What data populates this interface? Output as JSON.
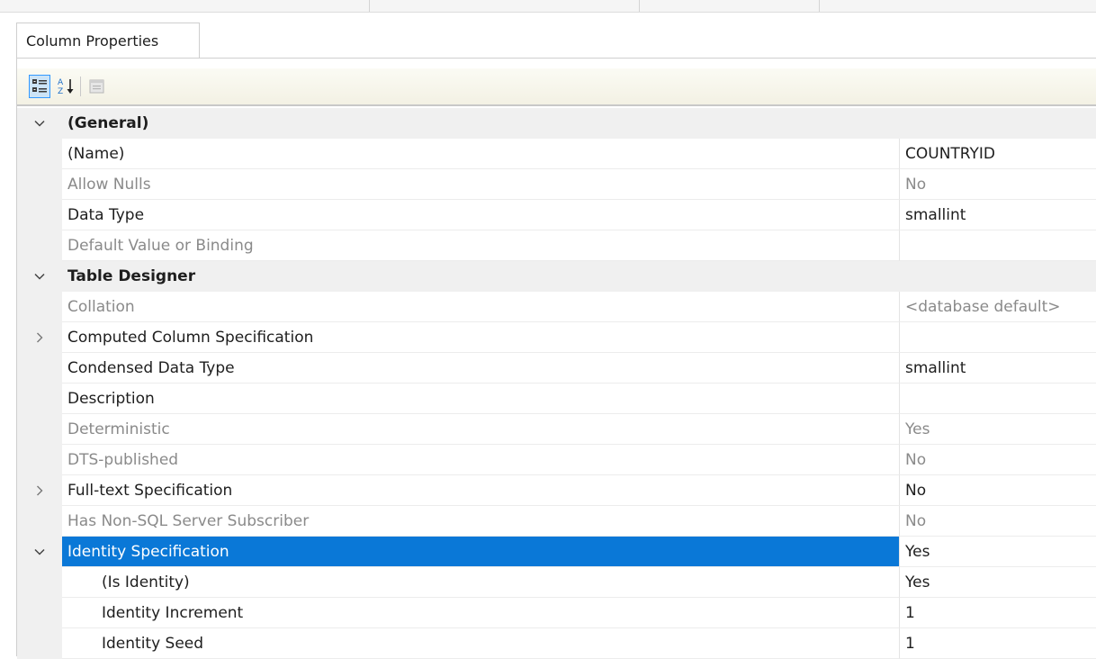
{
  "tab": {
    "label": "Column Properties"
  },
  "toolbar": {
    "buttons": [
      {
        "name": "categorized",
        "icon": "categorized-icon",
        "active": true
      },
      {
        "name": "alphabetical",
        "icon": "sort-alphabetical-icon",
        "active": false
      },
      {
        "name": "property-pages",
        "icon": "property-pages-icon",
        "active": false
      }
    ]
  },
  "properties": {
    "general": {
      "label": "(General)",
      "expanded": true
    },
    "name": {
      "label": "(Name)",
      "value": "COUNTRYID"
    },
    "allow_nulls": {
      "label": "Allow Nulls",
      "value": "No"
    },
    "data_type": {
      "label": "Data Type",
      "value": "smallint"
    },
    "default_value": {
      "label": "Default Value or Binding",
      "value": ""
    },
    "table_designer": {
      "label": "Table Designer",
      "expanded": true
    },
    "collation": {
      "label": "Collation",
      "value": "<database default>"
    },
    "computed_column": {
      "label": "Computed Column Specification",
      "value": ""
    },
    "condensed_data_type": {
      "label": "Condensed Data Type",
      "value": "smallint"
    },
    "description": {
      "label": "Description",
      "value": ""
    },
    "deterministic": {
      "label": "Deterministic",
      "value": "Yes"
    },
    "dts_published": {
      "label": "DTS-published",
      "value": "No"
    },
    "full_text": {
      "label": "Full-text Specification",
      "value": "No"
    },
    "non_sql_subscriber": {
      "label": "Has Non-SQL Server Subscriber",
      "value": "No"
    },
    "identity_spec": {
      "label": "Identity Specification",
      "value": "Yes"
    },
    "is_identity": {
      "label": "(Is Identity)",
      "value": "Yes"
    },
    "identity_increment": {
      "label": "Identity Increment",
      "value": "1"
    },
    "identity_seed": {
      "label": "Identity Seed",
      "value": "1"
    }
  },
  "colors": {
    "selection": "#0a78d7",
    "category_bg": "#f0f0f0",
    "disabled_text": "#8a8a8a"
  }
}
